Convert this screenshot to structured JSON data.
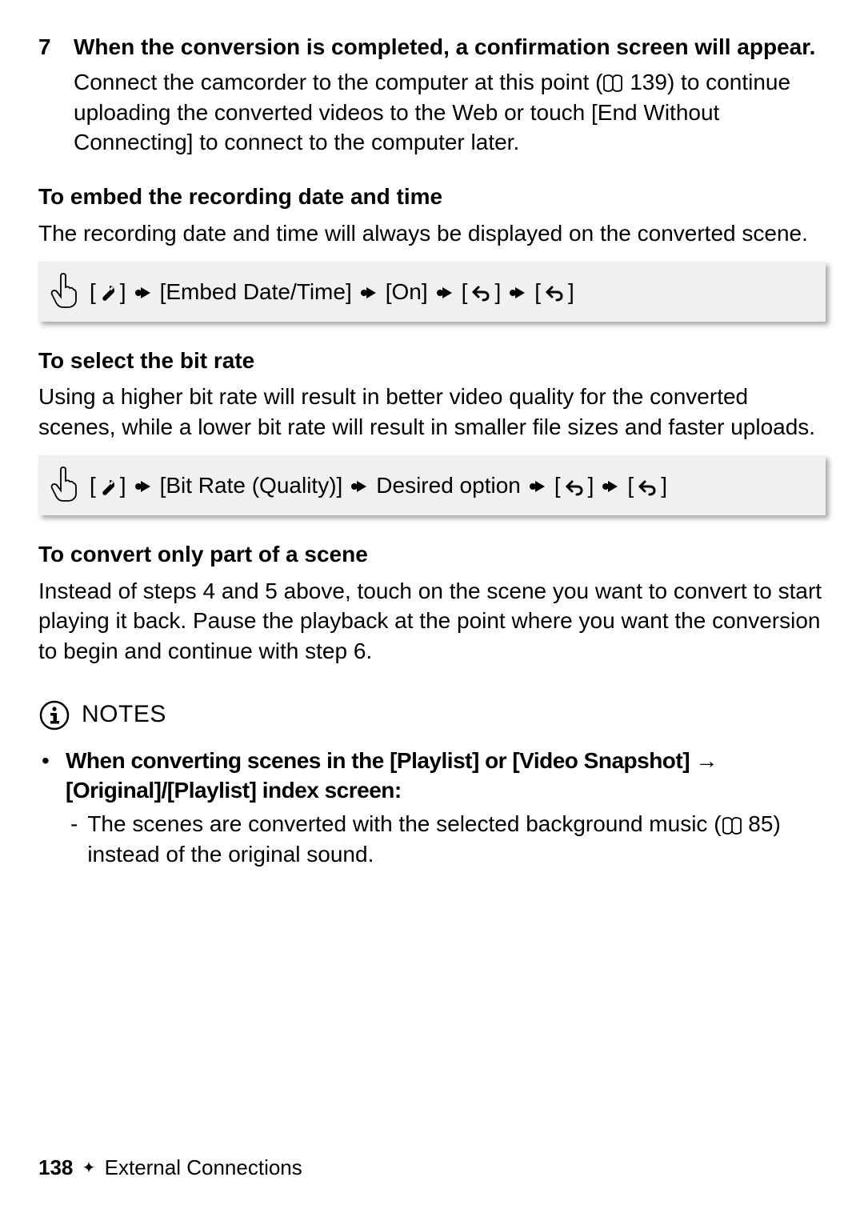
{
  "step": {
    "num": "7",
    "title": "When the conversion is completed, a confirmation screen will appear.",
    "body_parts": {
      "p1": "Connect the camcorder to the computer at this point (",
      "p_ref": " 139) to continue uploading the converted videos to the Web or touch [End Without Connecting] to connect to the computer later."
    }
  },
  "sections": {
    "embed": {
      "title": "To embed the recording date and time",
      "para": "The recording date and time will always be displayed on the converted scene.",
      "proc": {
        "t1": "[",
        "t2": "] ",
        "t3": " [Embed Date/Time] ",
        "t4": " [On] ",
        "t5": " [",
        "t6": "] ",
        "t7": " [",
        "t8": "]"
      }
    },
    "bitrate": {
      "title": "To select the bit rate",
      "para": "Using a higher bit rate will result in better video quality for the converted scenes, while a lower bit rate will result in smaller file sizes and faster uploads.",
      "proc": {
        "t1": "[",
        "t2": "] ",
        "t3": " [Bit Rate (Quality)] ",
        "t4": " Desired option ",
        "t5": " [",
        "t6": "] ",
        "t7": " [",
        "t8": "]"
      }
    },
    "part": {
      "title": "To convert only part of a scene",
      "para": "Instead of steps 4 and 5 above, touch on the scene you want to convert to start playing it back. Pause the playback at the point where you want the conversion to begin and continue with step 6."
    }
  },
  "notes": {
    "label": "NOTES",
    "bullet1": {
      "b1": "When converting scenes in the [Playlist] or [Video Snapshot] ",
      "arrow": "→",
      "b2": " [Original]/[Playlist] index screen:"
    },
    "sub1": {
      "p1": "The scenes are converted with the selected background music (",
      "p2": " 85) instead of the original sound."
    }
  },
  "footer": {
    "page": "138",
    "section": "External Connections"
  }
}
